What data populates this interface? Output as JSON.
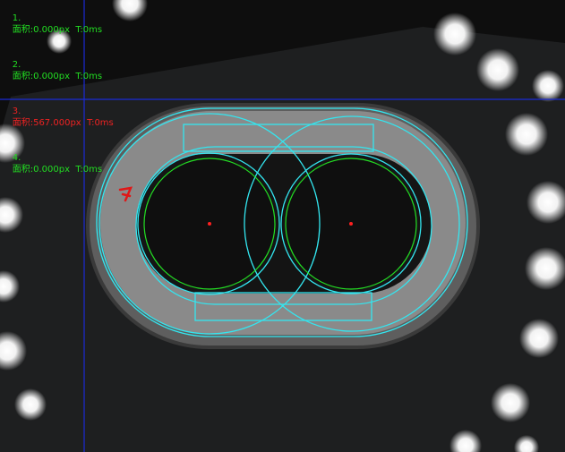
{
  "results": [
    {
      "index": "1.",
      "text": "面积:0.000px  T:0ms",
      "color": "#22dd22"
    },
    {
      "index": "2.",
      "text": "面积:0.000px  T:0ms",
      "color": "#22dd22"
    },
    {
      "index": "3.",
      "text": "面积:567.000px  T:0ms",
      "color": "#ee2222"
    },
    {
      "index": "4.",
      "text": "面积:0.000px  T:0ms",
      "color": "#22dd22"
    }
  ],
  "colors": {
    "roi": "#33e6f0",
    "fit_circle": "#22e022",
    "crosshair": "#1a2ad6",
    "center_point": "#ff2020",
    "defect": "#e01818"
  }
}
